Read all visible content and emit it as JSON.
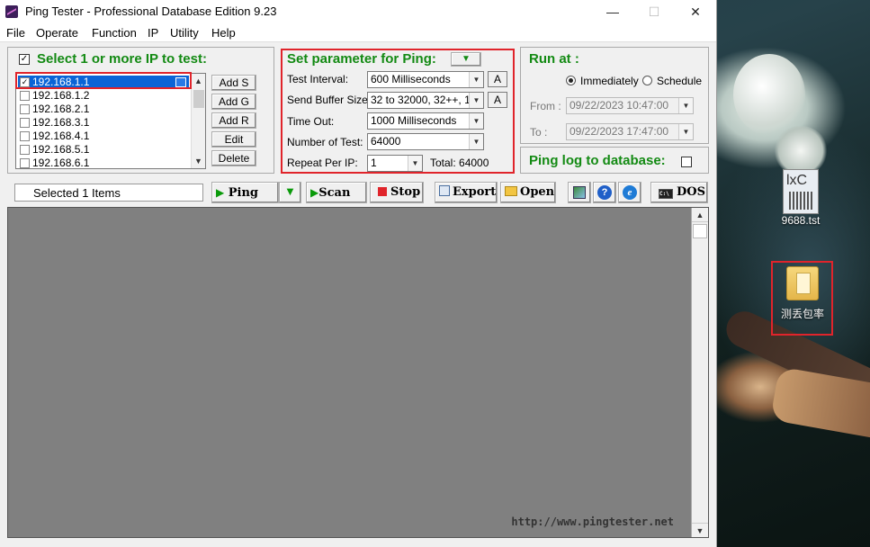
{
  "window": {
    "title": "Ping Tester - Professional Database Edition  9.23",
    "minimize": "—",
    "maximize": "☐",
    "close": "✕"
  },
  "menu": [
    "File",
    "Operate",
    "Function",
    "IP",
    "Utility",
    "Help"
  ],
  "ip_panel": {
    "heading": "Select 1 or more IP to test:",
    "heading_checked": true,
    "items": [
      {
        "label": "192.168.1.1",
        "checked": true,
        "selected": true
      },
      {
        "label": "192.168.1.2",
        "checked": false
      },
      {
        "label": "192.168.2.1",
        "checked": false
      },
      {
        "label": "192.168.3.1",
        "checked": false
      },
      {
        "label": "192.168.4.1",
        "checked": false
      },
      {
        "label": "192.168.5.1",
        "checked": false
      },
      {
        "label": "192.168.6.1",
        "checked": false
      }
    ],
    "buttons": [
      "Add S",
      "Add G",
      "Add R",
      "Edit",
      "Delete"
    ]
  },
  "params": {
    "heading": "Set parameter for Ping:",
    "test_interval_label": "Test Interval:",
    "test_interval": "600  Milliseconds",
    "send_buffer_label": "Send Buffer Size:",
    "send_buffer": "32 to 32000, 32++, 1",
    "timeout_label": "Time Out:",
    "timeout": "1000  Milliseconds",
    "num_tests_label": "Number of Test:",
    "num_tests": "64000",
    "repeat_label": "Repeat Per IP:",
    "repeat": "1",
    "total": "Total: 64000",
    "a_label": "A"
  },
  "run_at": {
    "heading": "Run at :",
    "immediately": "Immediately",
    "schedule": "Schedule",
    "from_label": "From :",
    "from": "09/22/2023 10:47:00",
    "to_label": "To :",
    "to": "09/22/2023 17:47:00",
    "mode": "immediately"
  },
  "log_db": {
    "label": "Ping log to database:",
    "checked": false
  },
  "toolbar": {
    "selected": "Selected 1 Items",
    "ping": "Ping",
    "scan": "Scan ip",
    "stop": "Stop",
    "export": "Export",
    "open": "Open",
    "dos": "DOS"
  },
  "website": "http://www.pingtester.net",
  "desktop": [
    {
      "name": "9688.tst",
      "icon": "tst-file-icon"
    },
    {
      "name": "测丢包率",
      "icon": "folder-icon"
    }
  ],
  "colors": {
    "heading_green": "#138a13",
    "highlight_red": "#e0242b",
    "selection_blue": "#0a64d6"
  }
}
